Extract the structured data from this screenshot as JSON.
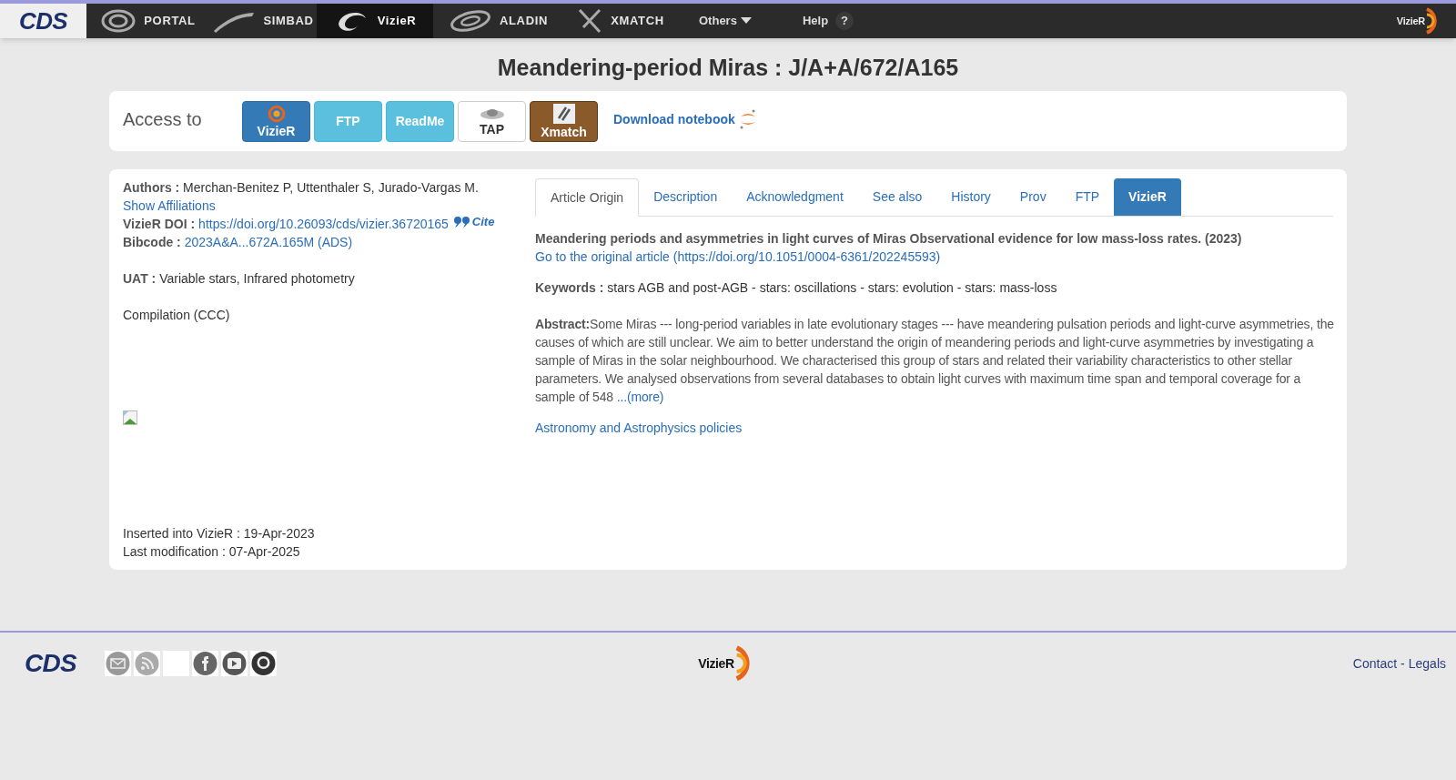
{
  "navbar": {
    "logo": "CDS",
    "items": [
      {
        "label": "PORTAL",
        "kind": "portal",
        "selected": false
      },
      {
        "label": "SIMBAD",
        "kind": "simbad",
        "selected": false
      },
      {
        "label": "VizieR",
        "kind": "vizier",
        "selected": true
      },
      {
        "label": "ALADIN",
        "kind": "aladin",
        "selected": false
      },
      {
        "label": "XMATCH",
        "kind": "xmatch",
        "selected": false
      }
    ],
    "menus": [
      {
        "label": "Others",
        "kind": "dropdown"
      },
      {
        "label": "Help",
        "kind": "help",
        "glyph": "?"
      }
    ],
    "right_logo": "VizieR"
  },
  "title": "Meandering-period Miras : J/A+A/672/A165",
  "access": {
    "label": "Access to",
    "buttons": [
      {
        "label": "VizieR",
        "kind": "vizier"
      },
      {
        "label": "FTP",
        "kind": "plain"
      },
      {
        "label": "ReadMe",
        "kind": "plain"
      },
      {
        "label": "TAP",
        "kind": "tap"
      },
      {
        "label": "Xmatch",
        "kind": "xmatch"
      }
    ],
    "notebook": "Download notebook"
  },
  "details": {
    "authors_label": "Authors :",
    "authors": "Merchan-Benitez P, Uttenthaler S, Jurado-Vargas M.",
    "affiliations_link": "Show Affiliations",
    "doi_label": "VizieR DOI :",
    "doi": "https://doi.org/10.26093/cds/vizier.36720165",
    "cite": "Cite",
    "bibcode_label": "Bibcode :",
    "bibcode": "2023A&A...672A.165M (ADS)",
    "uat_label": "UAT :",
    "uat": "Variable stars, Infrared photometry",
    "category": "Compilation (CCC)",
    "inserted": "Inserted into VizieR : 19-Apr-2023",
    "modified": "Last modification : 07-Apr-2025"
  },
  "tabs": [
    {
      "label": "Article Origin",
      "selected": true
    },
    {
      "label": "Description",
      "selected": false
    },
    {
      "label": "Acknowledgment",
      "selected": false
    },
    {
      "label": "See also",
      "selected": false
    },
    {
      "label": "History",
      "selected": false
    },
    {
      "label": "Prov",
      "selected": false
    },
    {
      "label": "FTP",
      "selected": false
    },
    {
      "label": "VizieR",
      "selected": false,
      "highlighted": true
    }
  ],
  "article": {
    "title": "Meandering periods and asymmetries in light curves of Miras Observational evidence for low mass-loss rates. (2023)",
    "link": "Go to the original article (https://doi.org/10.1051/0004-6361/202245593)",
    "keywords_label": "Keywords :",
    "keywords": "stars AGB and post-AGB - stars: oscillations - stars: evolution - stars: mass-loss",
    "abstract_label": "Abstract:",
    "abstract": "Some Miras --- long-period variables in late evolutionary stages --- have meandering pulsation periods and light-curve asymmetries, the causes of which are still unclear. We aim to better understand the origin of meandering periods and light-curve asymmetries by investigating a sample of Miras in the solar neighbourhood. We characterised this group of stars and related their variability characteristics to other stellar parameters. We analysed observations from several databases to obtain light curves with maximum time span and temporal coverage for a sample of 548",
    "more": "...(more)",
    "policies": "Astronomy and Astrophysics policies"
  },
  "footer": {
    "logo": "CDS",
    "center_logo": "VizieR",
    "links": [
      "Contact",
      "Legals"
    ],
    "separator": "-"
  }
}
